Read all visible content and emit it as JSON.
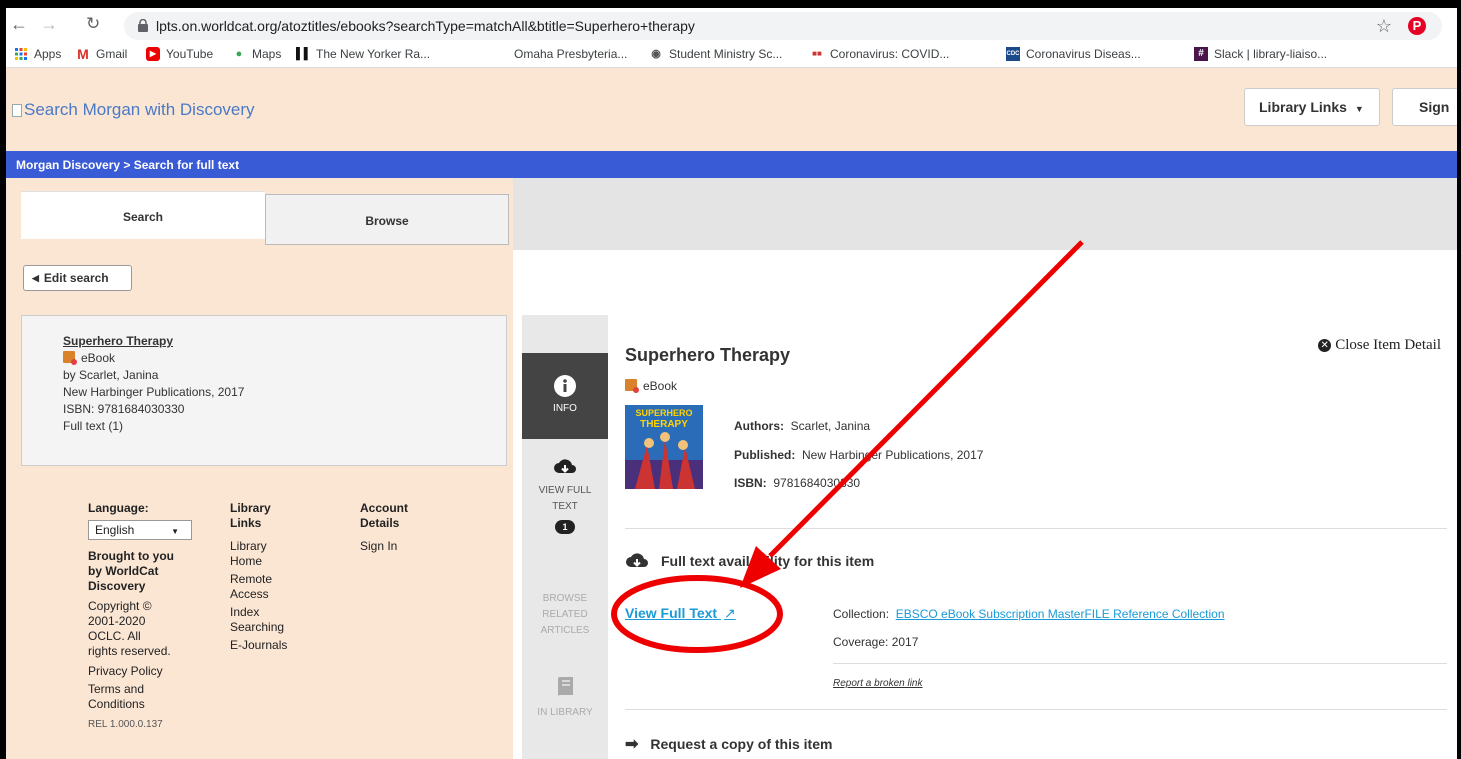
{
  "browser": {
    "url": "lpts.on.worldcat.org/atoztitles/ebooks?searchType=matchAll&btitle=Superhero+therapy",
    "bookmarks": [
      {
        "label": "Apps",
        "icon": "apps-grid-icon"
      },
      {
        "label": "Gmail",
        "icon": "gmail-icon"
      },
      {
        "label": "YouTube",
        "icon": "youtube-icon"
      },
      {
        "label": "Maps",
        "icon": "maps-pin-icon"
      },
      {
        "label": "The New Yorker Ra...",
        "icon": "bars-icon"
      },
      {
        "label": "Omaha Presbyteria...",
        "icon": ""
      },
      {
        "label": "Student Ministry Sc...",
        "icon": "globe-icon"
      },
      {
        "label": "Coronavirus: COVID...",
        "icon": "news-icon"
      },
      {
        "label": "Coronavirus Diseas...",
        "icon": "cdc-icon"
      },
      {
        "label": "Slack | library-liaiso...",
        "icon": "slack-icon"
      }
    ]
  },
  "header": {
    "logo_alt": "Search Morgan with Discovery",
    "library_links": "Library Links",
    "sign_in": "Sign",
    "breadcrumb": "Morgan Discovery >  Search for full text"
  },
  "tabs": {
    "search": "Search",
    "browse": "Browse"
  },
  "edit_search": "Edit search",
  "result": {
    "title": "Superhero Therapy",
    "format": "eBook",
    "author": "by Scarlet, Janina",
    "publisher": "New Harbinger Publications, 2017",
    "isbn": "ISBN: 9781684030330",
    "full_text": "Full text (1)"
  },
  "footer": {
    "language_label": "Language:",
    "language_value": "English",
    "brought": [
      "Brought to you",
      "by WorldCat",
      "Discovery"
    ],
    "copyright": [
      "Copyright ©",
      "2001-2020",
      "OCLC.  All",
      "rights reserved."
    ],
    "privacy": "Privacy Policy",
    "terms": [
      "Terms and",
      "Conditions"
    ],
    "rel": "REL 1.000.0.137",
    "library_links_head": [
      "Library",
      "Links"
    ],
    "library_links": [
      "Library",
      "Home",
      "Remote",
      "Access",
      "Index",
      "Searching",
      "E-Journals"
    ],
    "account_head": [
      "Account",
      "Details"
    ],
    "account_links": [
      "Sign In"
    ]
  },
  "rail": {
    "info": "INFO",
    "view_full_text": [
      "VIEW FULL",
      "TEXT"
    ],
    "badge": "1",
    "browse_related": [
      "BROWSE",
      "RELATED",
      "ARTICLES"
    ],
    "in_library": "IN LIBRARY"
  },
  "detail": {
    "close": "Close Item Detail",
    "title": "Superhero Therapy",
    "format": "eBook",
    "authors_label": "Authors:",
    "authors": "Scarlet, Janina",
    "published_label": "Published:",
    "published": "New Harbinger Publications, 2017",
    "isbn_label": "ISBN:",
    "isbn": "9781684030330",
    "cover_text": [
      "SUPERHERO",
      "THERAPY"
    ],
    "fulltext_head": "Full text availability for this item",
    "view_full_text": "View Full Text",
    "collection_label": "Collection:",
    "collection": "EBSCO eBook Subscription MasterFILE Reference Collection",
    "coverage": "Coverage: 2017",
    "report": "Report a broken link",
    "request_head": "Request a copy of this item"
  },
  "colors": {
    "annotation": "#ee0000",
    "link": "#1a9ad6",
    "bluebar": "#3a5bd6",
    "header_bg": "#fbe6d4"
  }
}
